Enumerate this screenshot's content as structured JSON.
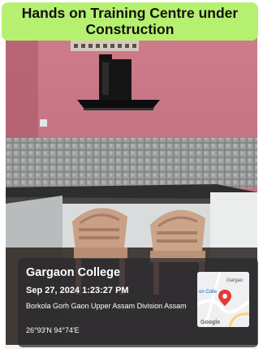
{
  "banner": {
    "text": "Hands on Training Centre under Construction"
  },
  "geotag": {
    "place": "Gargaon College",
    "datetime": "Sep 27, 2024 1:23:27 PM",
    "address": "Borkola Gorh Gaon Upper Assam Division Assam",
    "coordinates": "26°93'N 94°74'E"
  },
  "map": {
    "label_1": "Gargao",
    "label_2": "on Colle",
    "brand": "Google",
    "pin_color": "#e53935"
  },
  "colors": {
    "wall": "#c4707f",
    "banner_bg": "#b6f070"
  }
}
